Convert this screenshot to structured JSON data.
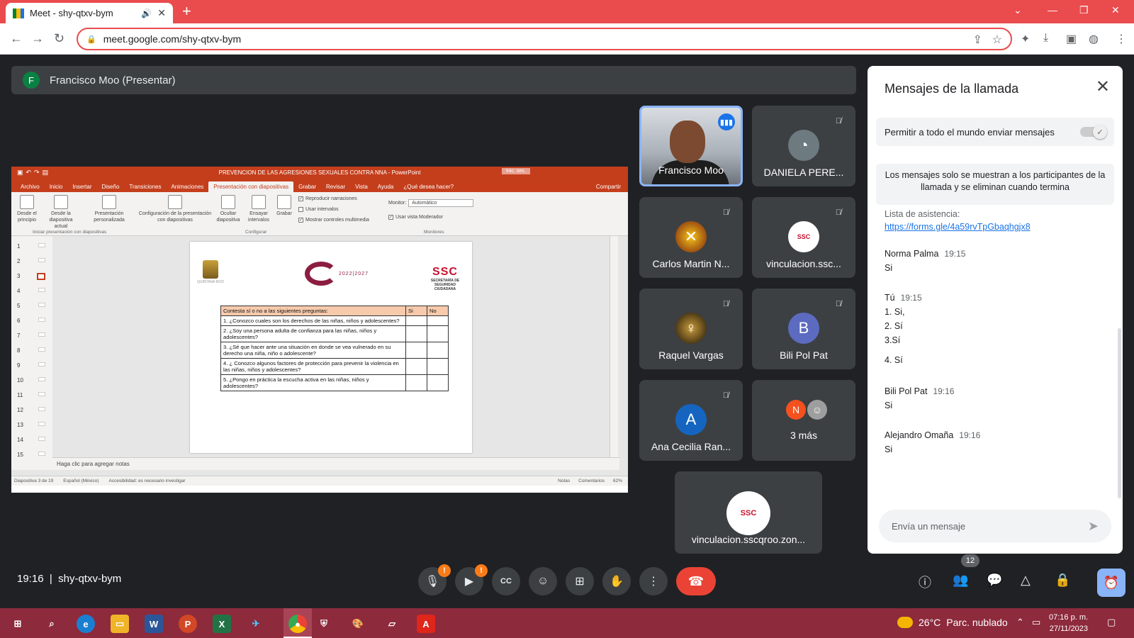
{
  "browser": {
    "tab_title": "Meet - shy-qtxv-bym",
    "url": "meet.google.com/shy-qtxv-bym",
    "icons": [
      "back-icon",
      "forward-icon",
      "reload-icon",
      "lock-icon",
      "share-icon",
      "star-icon",
      "puzzle-icon",
      "download-icon",
      "sidebar-icon",
      "profile-icon",
      "menu-icon"
    ],
    "accent": "#ea4b4d"
  },
  "presenter": {
    "initial": "F",
    "label": "Francisco Moo (Presentar)"
  },
  "ppt": {
    "title": "PREVENCION DE LAS AGRESIONES SEXUALES CONTRA NNA  -  PowerPoint",
    "inic_label": "Inic. ses.",
    "menu": [
      "Archivo",
      "Inicio",
      "Insertar",
      "Diseño",
      "Transiciones",
      "Animaciones",
      "Presentación con diapositivas",
      "Grabar",
      "Revisar",
      "Vista",
      "Ayuda",
      "¿Qué desea hacer?"
    ],
    "share": "Compartir",
    "ribbon": {
      "desde_principio": "Desde el principio",
      "desde_actual": "Desde la diapositiva actual",
      "personalizada": "Presentación personalizada",
      "configuracion": "Configuración de la presentación con diapositivas",
      "ocultar": "Ocultar diapositiva",
      "ensayar": "Ensayar intervalos",
      "grabar": "Grabar",
      "reproducir": "Reproducir narraciones",
      "usar_intervalos": "Usar intervalos",
      "mostrar_controles": "Mostrar controles multimedia",
      "monitor_label": "Monitor:",
      "monitor_value": "Automático",
      "vista_moderador": "Usar vista Moderador",
      "group_iniciar": "Iniciar presentación con diapositivas",
      "group_configurar": "Configurar",
      "group_monitores": "Monitores"
    },
    "slide_numbers": [
      "1",
      "2",
      "3",
      "4",
      "5",
      "6",
      "7",
      "8",
      "9",
      "10",
      "11",
      "12",
      "13",
      "14",
      "15"
    ],
    "slide": {
      "qroo": "QUINTANA ROO",
      "q_years": "2022|2027",
      "ssc": "SSC",
      "ssc_sub": "SECRETARÍA DE SEGURIDAD CIUDADANA",
      "table_header": "Contesta sí o no a las siguientes preguntas:",
      "col_si": "Si",
      "col_no": "No",
      "questions": [
        "1. ¿Conozco cuales son los derechos de las niñas, niños y adolescentes?",
        "2. ¿Soy una persona adulta de confianza para las niñas, niños y adolescentes?",
        "3. ¿Sé que hacer ante una situación en donde se vea vulnerado en su derecho una niña, niño o adolescente?",
        "4. ¿ Conozco algunos factores de protección para prevenir la violencia en las niñas, niños y adolescentes?",
        "5. ¿Pongo en práctica la escucha activa en las niñas, niños y adolescentes?"
      ]
    },
    "notes_placeholder": "Haga clic para agregar notas",
    "status": {
      "slide_pos": "Diapositiva 3 de 19",
      "lang": "Español (México)",
      "access": "Accesibilidad: es necesario investigar",
      "notas": "Notas",
      "comentarios": "Comentarios",
      "zoom": "62%"
    }
  },
  "participants": [
    {
      "name": "Francisco Moo"
    },
    {
      "name": "DANIELA PERE..."
    },
    {
      "name": "Carlos Martin N..."
    },
    {
      "name": "vinculacion.ssc..."
    },
    {
      "name": "Raquel Vargas"
    },
    {
      "name": "Bili Pol Pat",
      "initial": "B"
    },
    {
      "name": "Ana Cecilia Ran...",
      "initial": "A"
    },
    {
      "name": "3 más",
      "initial": "N"
    },
    {
      "name": "vinculacion.sscqroo.zon..."
    }
  ],
  "chat": {
    "title": "Mensajes de la llamada",
    "allow_label": "Permitir a todo el mundo enviar mensajes",
    "notice": "Los mensajes solo se muestran a los participantes de la llamada y se eliminan cuando termina",
    "partial_text": "Lista de asistencia:",
    "link": "https://forms.gle/4a59rvTpGbaqhgjx8",
    "messages": [
      {
        "sender": "Norma Palma",
        "time": "19:15",
        "lines": [
          "Si"
        ]
      },
      {
        "sender": "Tú",
        "time": "19:15",
        "lines": [
          "1. Si,",
          "2. Sí",
          "3.Sí",
          "4. Sí"
        ]
      },
      {
        "sender": "Bili Pol Pat",
        "time": "19:16",
        "lines": [
          "Si"
        ]
      },
      {
        "sender": "Alejandro Omaña",
        "time": "19:16",
        "lines": [
          "Si"
        ]
      }
    ],
    "input_placeholder": "Envía un mensaje"
  },
  "bottom": {
    "time": "19:16",
    "meeting_code": "shy-qtxv-bym",
    "participant_count": "12"
  },
  "taskbar": {
    "temperature": "26°C",
    "weather": "Parc. nublado",
    "time": "07:16 p. m.",
    "date": "27/11/2023"
  }
}
